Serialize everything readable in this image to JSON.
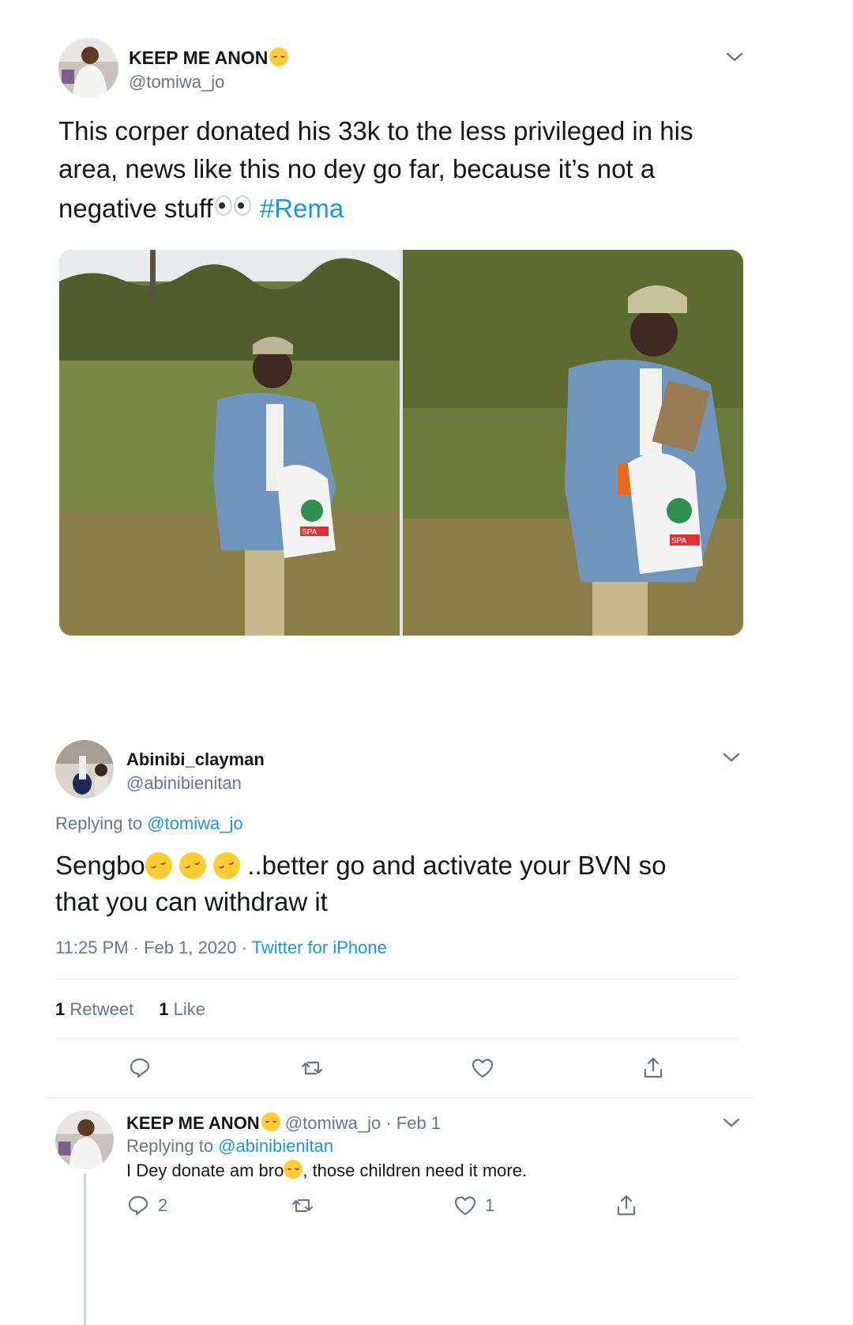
{
  "tweet": {
    "author_name": "KEEP ME ANON",
    "author_handle": "@tomiwa_jo",
    "text_main": "This corper donated his 33k to the less privileged in his area, news like this no dey go far, because it’s not a negative stuff",
    "hashtag": "#Rema",
    "photo_1_label": "SPA",
    "photo_2_label": "SPA"
  },
  "reply": {
    "author_name": "Abinibi_clayman",
    "author_handle": "@abinibienitan",
    "replying_prefix": "Replying to",
    "replying_to": "@tomiwa_jo",
    "text_start": "Sengbo",
    "text_rest_line1": "..better go and activate your BVN so",
    "text_line2": "that you can withdraw it",
    "timestamp": "11:25 PM · Feb 1, 2020 · ",
    "source": "Twitter for iPhone",
    "retweets_count": "1",
    "retweets_label": "Retweet",
    "likes_count": "1",
    "likes_label": "Like"
  },
  "nested_reply": {
    "author_name": "KEEP ME ANON",
    "author_handle": "@tomiwa_jo",
    "date": "· Feb 1",
    "replying_prefix": "Replying to",
    "replying_to": "@abinibienitan",
    "text_start": "I Dey donate am bro",
    "text_end": ", those children need it more.",
    "reply_count": "2",
    "like_count": "1"
  },
  "icons": {
    "reply": "reply-icon",
    "retweet": "retweet-icon",
    "like": "heart-icon",
    "share": "share-icon",
    "more": "chevron-down-icon"
  },
  "colors": {
    "link": "#1b95e0",
    "muted": "#657786",
    "text": "#14171a",
    "divider": "#e6ecf0"
  }
}
